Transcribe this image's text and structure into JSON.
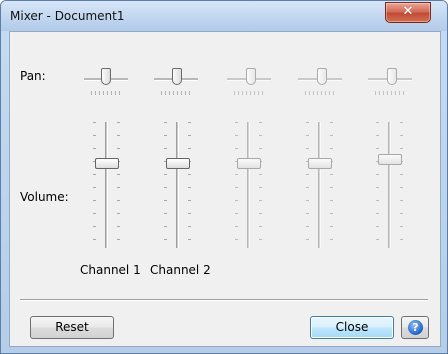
{
  "window": {
    "title": "Mixer - Document1",
    "close_glyph": "✕"
  },
  "labels": {
    "pan": "Pan:",
    "volume": "Volume:"
  },
  "channels": [
    {
      "name": "Channel 1",
      "enabled": true,
      "pan": 0.5,
      "volume": 0.6
    },
    {
      "name": "Channel 2",
      "enabled": true,
      "pan": 0.5,
      "volume": 0.6
    },
    {
      "name": "",
      "enabled": false,
      "pan": 0.5,
      "volume": 0.6
    },
    {
      "name": "",
      "enabled": false,
      "pan": 0.5,
      "volume": 0.6
    },
    {
      "name": "",
      "enabled": false,
      "pan": 0.5,
      "volume": 0.64
    }
  ],
  "buttons": {
    "reset": "Reset",
    "close": "Close",
    "help_icon": "help-icon",
    "help_glyph": "?"
  },
  "colors": {
    "title_bar": "#bfd5ef",
    "close_button": "#c24a36",
    "default_button": "#bee6fd",
    "client_bg": "#f0f0f0"
  }
}
